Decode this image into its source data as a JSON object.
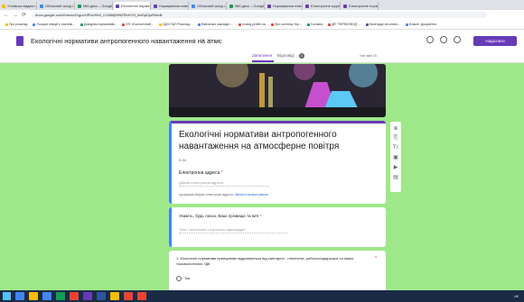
{
  "browser": {
    "tabs": [
      {
        "label": "Учнівські вадачі",
        "color": "#fbbc04"
      },
      {
        "label": "Обласний захід і...",
        "color": "#4285f4"
      },
      {
        "label": "Мій диск – Google...",
        "color": "#0f9d58"
      },
      {
        "label": "Екологічні нормати...",
        "color": "#673ab7"
      },
      {
        "label": "Нормування навчал...",
        "color": "#673ab7"
      },
      {
        "label": "Обласний захід і...",
        "color": "#4285f4"
      },
      {
        "label": "Мій диск – Google...",
        "color": "#0f9d58"
      },
      {
        "label": "Нормування навчал...",
        "color": "#673ab7"
      },
      {
        "label": "Електронне журнал...",
        "color": "#673ab7"
      },
      {
        "label": "Електронне нормат...",
        "color": "#673ab7"
      }
    ],
    "url": "docs.google.com/forms/d/1guoHRhUHb2_Cr36MjW9fZRbhY0l_6wSpDjuRt/edit",
    "back_icon": "back-arrow-icon",
    "forward_icon": "forward-arrow-icon",
    "reload_icon": "reload-icon",
    "bookmarks": [
      {
        "label": "Про розклад",
        "color": "#fbbc04"
      },
      {
        "label": "Пошуки лекцій у системі...",
        "color": "#4285f4"
      },
      {
        "label": "Довідник нормативів...",
        "color": "#0f9d58"
      },
      {
        "label": "ЕП «Екологічний...",
        "color": "#ea4335"
      },
      {
        "label": "СДН-ПАП Розклад...",
        "color": "#fbbc04"
      },
      {
        "label": "Навчальні заклади і...",
        "color": "#4285f4"
      },
      {
        "label": "еcolog-profile.ua",
        "color": "#ea4335"
      },
      {
        "label": "Про систему Укр...",
        "color": "#ea4335"
      },
      {
        "label": "Головна",
        "color": "#0f9d58"
      },
      {
        "label": "ДП \"УКРЕКОБУД\"...",
        "color": "#ea4335"
      },
      {
        "label": "Календар на семес...",
        "color": "#673ab7"
      },
      {
        "label": "Власні: Документи",
        "color": "#4285f4"
      }
    ]
  },
  "form_header": {
    "title": "Екологічні нормативи антропогенного навантаження на атмс",
    "send_label": "Надіслати",
    "folder_icon": "folder-icon",
    "star_icon": "star-icon"
  },
  "form_tabs": {
    "questions": "Запитання",
    "responses": "Відповіді",
    "response_count": "3",
    "saved": "Усіх змін 15"
  },
  "title_card": {
    "title": "Екологічні нормативи антропогенного навантаження на атмосферне повітря",
    "subtitle": "9-34",
    "email_label": "Електронна адреса",
    "email_placeholder": "Дійсна електронна адреса",
    "collect_text": "Ця форма збирає електронні адреси.",
    "collect_link": "Змінити налаштування"
  },
  "question1": {
    "label": "Укажіть, будь ласка, Ваші прізвище та ім'я",
    "placeholder": "Текст запитання з короткою відповіддю"
  },
  "question2": {
    "label": "1.      Екологічні нормативи принципово відрізняються від санітарно - гігієнічних, рибогосподарських та інших токсикологічних ГДК",
    "option": "Так"
  },
  "taskbar": {
    "apps": [
      "#4285f4",
      "#fbbc04",
      "#4285f4",
      "#0f9d58",
      "#ea4335",
      "#673ab7",
      "#2b579a",
      "#fbbc04",
      "#ea4335",
      "#ea4335"
    ],
    "tray_text": "UK"
  }
}
